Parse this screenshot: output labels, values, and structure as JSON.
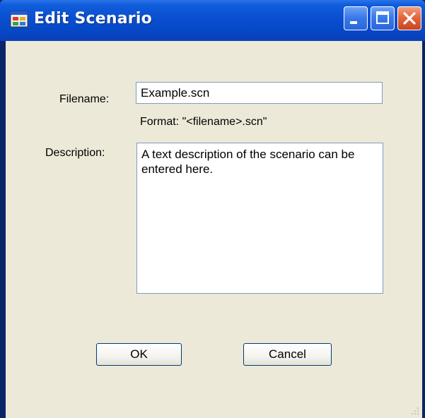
{
  "window": {
    "title": "Edit Scenario",
    "icon": "application-window-icon",
    "controls": [
      "minimize",
      "maximize",
      "close"
    ],
    "colors": {
      "titlebar": "#0a4fd0",
      "client_background": "#ece9d8",
      "close_button": "#e4673e"
    }
  },
  "form": {
    "filename": {
      "label": "Filename:",
      "value": "Example.scn"
    },
    "format_hint": "Format: \"<filename>.scn\"",
    "description": {
      "label": "Description:",
      "value": "A text description of the scenario can be entered here."
    }
  },
  "buttons": {
    "ok_label": "OK",
    "cancel_label": "Cancel"
  }
}
